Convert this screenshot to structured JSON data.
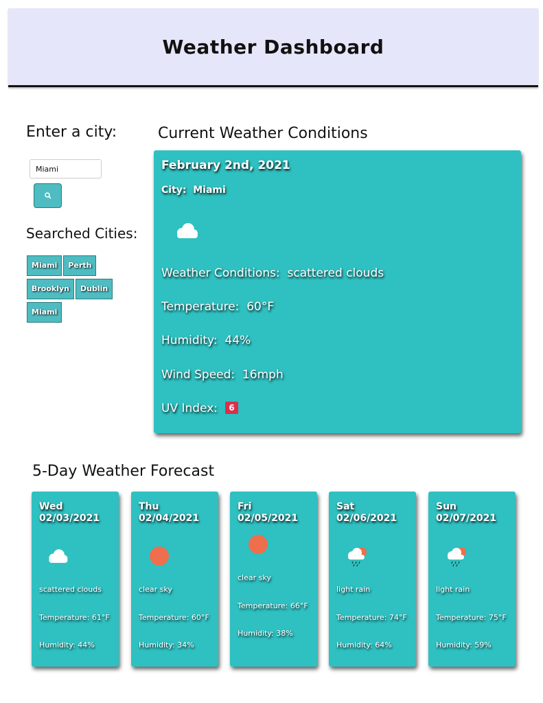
{
  "header": {
    "title": "Weather Dashboard"
  },
  "sidebar": {
    "enter_city_label": "Enter a city:",
    "search_value": "Miami",
    "searched_label": "Searched Cities:",
    "cities": [
      "Miami",
      "Perth",
      "Brooklyn",
      "Dublin",
      "Miami"
    ]
  },
  "current": {
    "section_title": "Current Weather Conditions",
    "date": "February 2nd, 2021",
    "city_label": "City:",
    "city": "Miami",
    "icon": "cloud-icon",
    "conditions_label": "Weather Conditions:",
    "conditions": "scattered clouds",
    "temp_label": "Temperature:",
    "temp": "60°F",
    "humidity_label": "Humidity:",
    "humidity": "44%",
    "wind_label": "Wind Speed:",
    "wind": "16mph",
    "uv_label": "UV Index:",
    "uv": "6",
    "uv_color": "#d9314c"
  },
  "forecast": {
    "section_title": "5-Day Weather Forecast",
    "days": [
      {
        "date": "Wed 02/03/2021",
        "icon": "cloud-icon",
        "desc": "scattered clouds",
        "temp": "Temperature: 61°F",
        "humidity": "Humidity: 44%"
      },
      {
        "date": "Thu 02/04/2021",
        "icon": "sun-icon",
        "desc": "clear sky",
        "temp": "Temperature: 60°F",
        "humidity": "Humidity: 34%"
      },
      {
        "date": "Fri 02/05/2021",
        "icon": "sun-icon",
        "desc": "clear sky",
        "temp": "Temperature: 66°F",
        "humidity": "Humidity: 38%"
      },
      {
        "date": "Sat 02/06/2021",
        "icon": "rain-icon",
        "desc": "light rain",
        "temp": "Temperature: 74°F",
        "humidity": "Humidity: 64%"
      },
      {
        "date": "Sun 02/07/2021",
        "icon": "rain-icon",
        "desc": "light rain",
        "temp": "Temperature: 75°F",
        "humidity": "Humidity: 59%"
      }
    ]
  },
  "colors": {
    "card": "#2fc0c1",
    "header_bg": "#e6e6fa",
    "button": "#4ebcc1",
    "sun": "#ee6e4d"
  }
}
